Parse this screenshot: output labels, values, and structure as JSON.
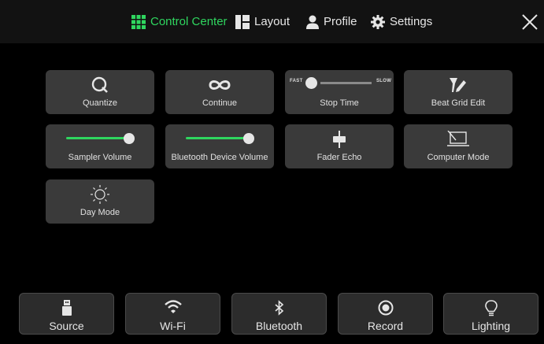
{
  "header": {
    "tabs": [
      {
        "label": "Control Center",
        "icon": "grid-icon",
        "active": true
      },
      {
        "label": "Layout",
        "icon": "layout-icon",
        "active": false
      },
      {
        "label": "Profile",
        "icon": "person-icon",
        "active": false
      },
      {
        "label": "Settings",
        "icon": "gear-icon",
        "active": false
      }
    ],
    "close_icon": "close-icon"
  },
  "tiles": {
    "quantize": {
      "label": "Quantize",
      "icon": "quantize-icon"
    },
    "continue": {
      "label": "Continue",
      "icon": "infinity-icon"
    },
    "stop_time": {
      "label": "Stop Time",
      "fast": "FAST",
      "slow": "SLOW",
      "value": 0.0
    },
    "beat_grid_edit": {
      "label": "Beat Grid Edit",
      "icon": "beat-grid-edit-icon"
    },
    "sampler_volume": {
      "label": "Sampler Volume",
      "value": 1.0
    },
    "bluetooth_device_volume": {
      "label": "Bluetooth Device Volume",
      "value": 1.0
    },
    "fader_echo": {
      "label": "Fader Echo",
      "icon": "fader-icon"
    },
    "computer_mode": {
      "label": "Computer Mode",
      "icon": "laptop-icon"
    },
    "day_mode": {
      "label": "Day Mode",
      "icon": "sun-icon"
    }
  },
  "bottom_bar": [
    {
      "label": "Source",
      "icon": "usb-icon"
    },
    {
      "label": "Wi-Fi",
      "icon": "wifi-icon"
    },
    {
      "label": "Bluetooth",
      "icon": "bluetooth-icon"
    },
    {
      "label": "Record",
      "icon": "record-icon"
    },
    {
      "label": "Lighting",
      "icon": "lightbulb-icon"
    }
  ],
  "colors": {
    "accent": "#2fd65f",
    "tile_bg": "#3a3a3a",
    "topbar_bg": "#121212",
    "background": "#000000"
  }
}
